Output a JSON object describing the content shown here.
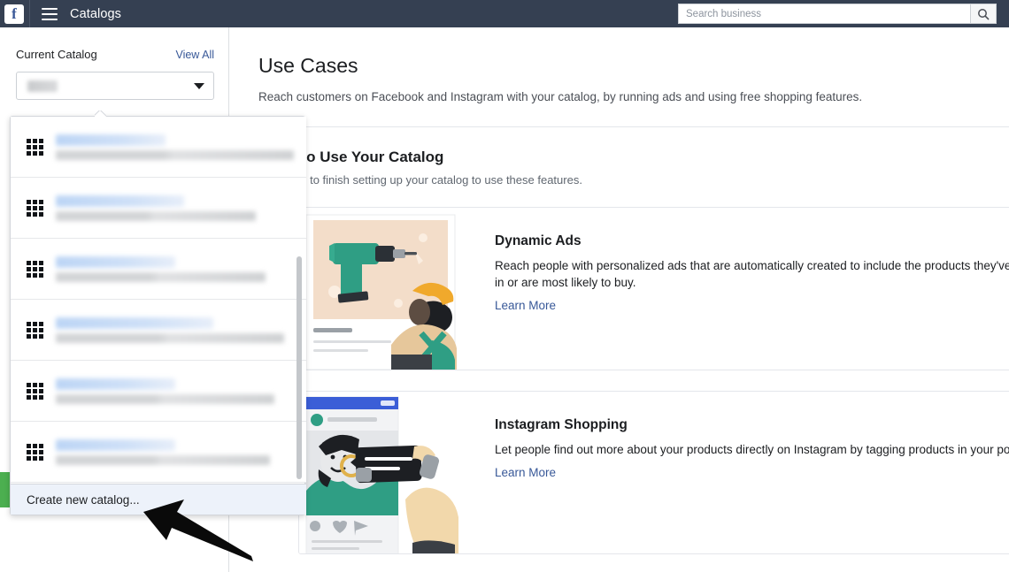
{
  "topbar": {
    "logo": "facebook-logo",
    "logo_letter": "f",
    "menu_icon": "hamburger-menu-icon",
    "title": "Catalogs",
    "search": {
      "placeholder": "Search business",
      "value": "",
      "icon": "search-icon"
    }
  },
  "sidebar": {
    "label": "Current Catalog",
    "view_all": "View All",
    "selected_catalog": "",
    "chevron": "chevron-down-icon"
  },
  "dropdown": {
    "items": [
      {
        "icon": "grid-icon",
        "title": "",
        "subtitle": ""
      },
      {
        "icon": "grid-icon",
        "title": "",
        "subtitle": ""
      },
      {
        "icon": "grid-icon",
        "title": "",
        "subtitle": ""
      },
      {
        "icon": "grid-icon",
        "title": "",
        "subtitle": ""
      },
      {
        "icon": "grid-icon",
        "title": "",
        "subtitle": ""
      },
      {
        "icon": "grid-icon",
        "title": "",
        "subtitle": ""
      }
    ],
    "footer_label": "Create new catalog..."
  },
  "main": {
    "page_title": "Use Cases",
    "page_subtitle": "Reach customers on Facebook and Instagram with your catalog, by running ads and using free shopping features.",
    "section_title": "Ways to Use Your Catalog",
    "section_subtitle": "You need to finish setting up your catalog to use these features.",
    "cards": [
      {
        "art": "drill-ad-illustration",
        "title": "Dynamic Ads",
        "description": "Reach people with personalized ads that are automatically created to include the products they've shown an interest in or are most likely to buy.",
        "link": "Learn More"
      },
      {
        "art": "instagram-tagging-illustration",
        "title": "Instagram Shopping",
        "description": "Let people find out more about your products directly on Instagram by tagging products in your posts and Stories.",
        "link": "Learn More"
      }
    ]
  },
  "annotation": {
    "arrow": "pointer-arrow-to-create-new-catalog"
  },
  "colors": {
    "topbar": "#354052",
    "link": "#385898",
    "footer_highlight": "#edf2fa",
    "accent_green": "#4caf50"
  }
}
